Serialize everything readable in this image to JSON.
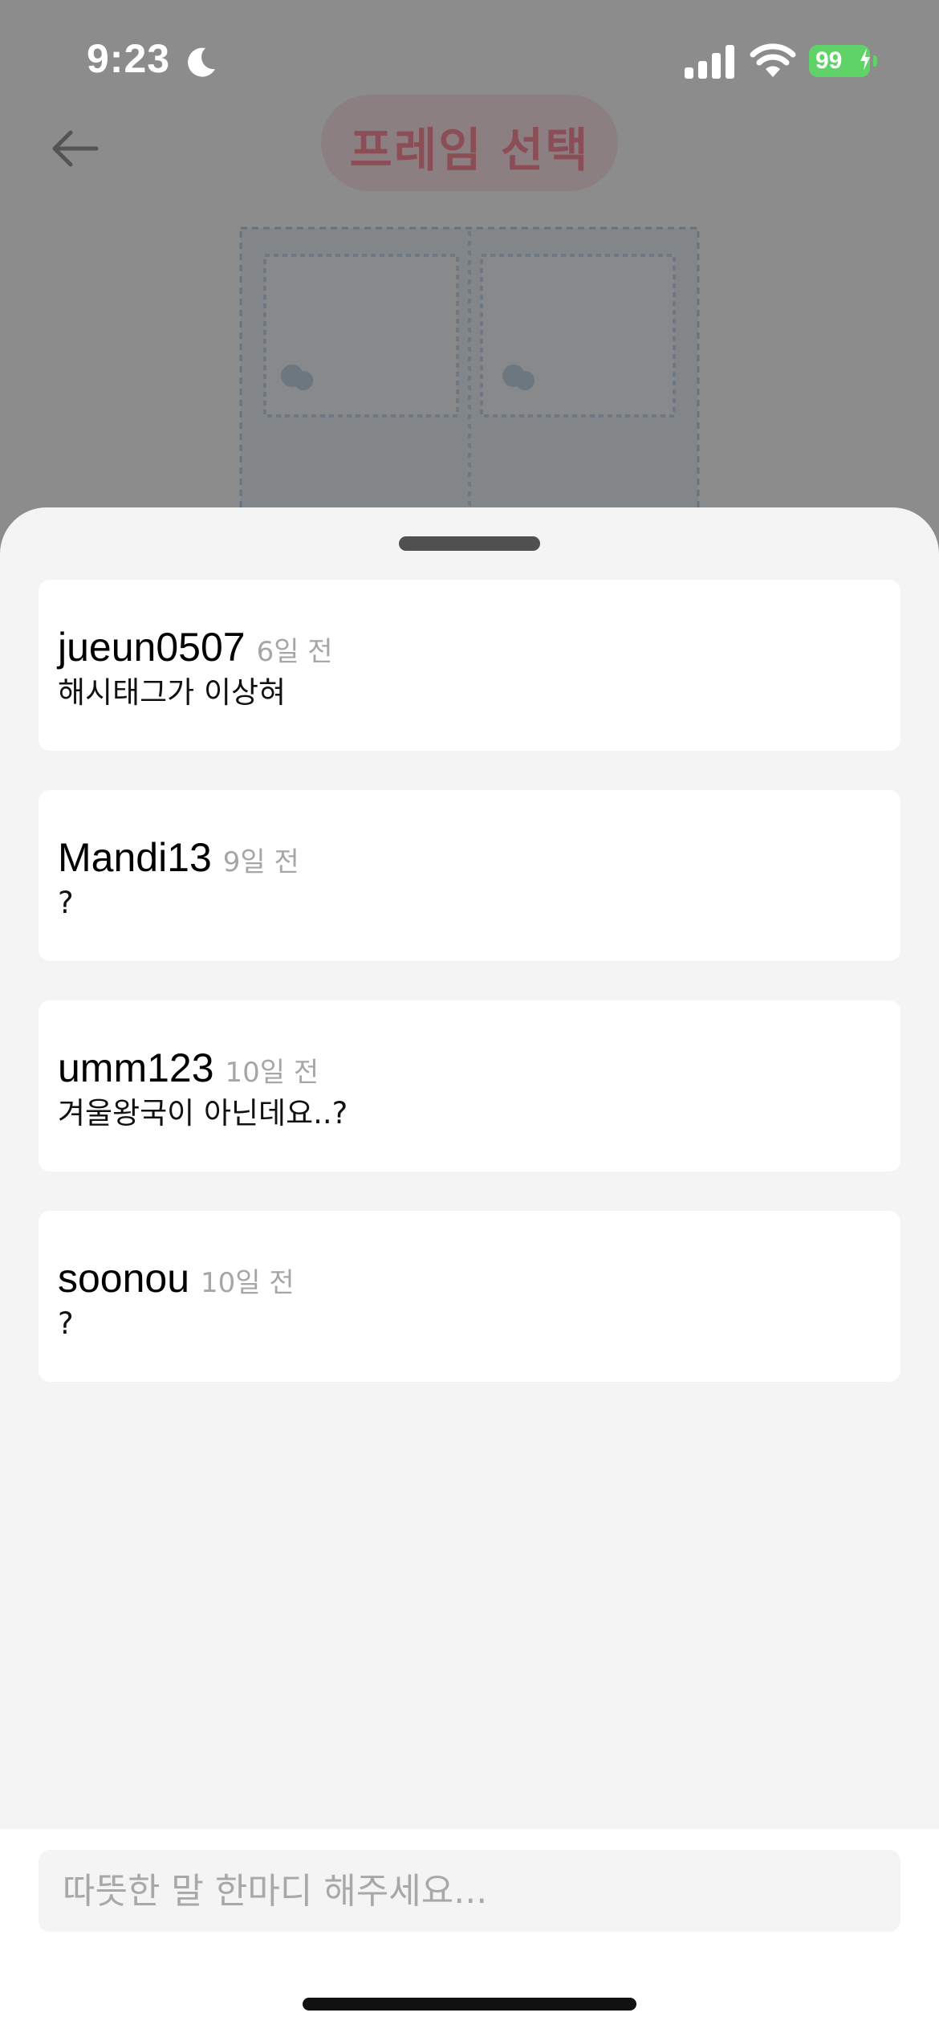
{
  "status_bar": {
    "time": "9:23",
    "battery": "99",
    "icons": [
      "moon-icon",
      "signal-icon",
      "wifi-icon",
      "battery-icon",
      "charging-bolt-icon"
    ]
  },
  "background_screen": {
    "title": "프레임 선택",
    "icons": [
      "back-arrow-icon"
    ]
  },
  "comments": [
    {
      "user": "jueun0507",
      "time": "6일 전",
      "text": "해시태그가 이상혀"
    },
    {
      "user": "Mandi13",
      "time": "9일 전",
      "text": "?"
    },
    {
      "user": "umm123",
      "time": "10일 전",
      "text": "겨울왕국이 아닌데요..?"
    },
    {
      "user": "soonou",
      "time": "10일 전",
      "text": "?"
    }
  ],
  "input": {
    "placeholder": "따뜻한 말 한마디 해주세요..."
  },
  "colors": {
    "overlay": "#000000",
    "sheet_background": "#f4f4f4",
    "card_background": "#ffffff",
    "timestamp": "#a6a6a6",
    "accent_title": "#ff8f9d",
    "battery_green": "#5fd367"
  }
}
